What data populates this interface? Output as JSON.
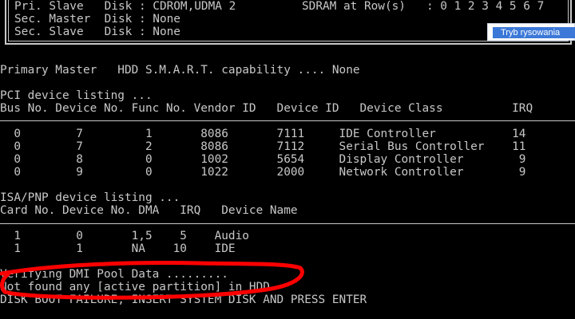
{
  "bios_header": {
    "row1": "Pri. Slave   Disk : CDROM,UDMA 2",
    "row1_right": "SDRAM at Row(s)   : 0 1 2 3 4 5 6 7",
    "row2": "Sec. Master  Disk : None",
    "row3": "Sec. Slave   Disk : None"
  },
  "tooltip": {
    "label": "Tryb rysowania"
  },
  "smart_line": "Primary Master   HDD S.M.A.R.T. capability .... None",
  "pci": {
    "title": "PCI device listing ...",
    "header": "Bus No. Device No. Func No. Vendor ID   Device ID   Device Class          IRQ",
    "rows": [
      "  0        7         1       8086       7111     IDE Controller           14",
      "  0        7         2       8086       7112     Serial Bus Controller    11",
      "  0        8         0       1002       5654     Display Controller        9",
      "  0        9         0       1022       2000     Network Controller        9"
    ]
  },
  "isa": {
    "title": "ISA/PNP device listing ...",
    "header": "Card No. Device No. DMA   IRQ   Device Name",
    "rows": [
      "  1        0       1,5    5    Audio",
      "  1        1       NA    10    IDE"
    ]
  },
  "messages": {
    "verify": "Verifying DMI Pool Data .........",
    "not_found": "Not found any [active partition] in HDD",
    "boot_failure": "DISK BOOT FAILURE, INSERT SYSTEM DISK AND PRESS ENTER"
  },
  "colors": {
    "text": "#c8c8c8",
    "background": "#000000",
    "annotation": "#ff0000",
    "tooltip_accent": "#3b78d8"
  }
}
